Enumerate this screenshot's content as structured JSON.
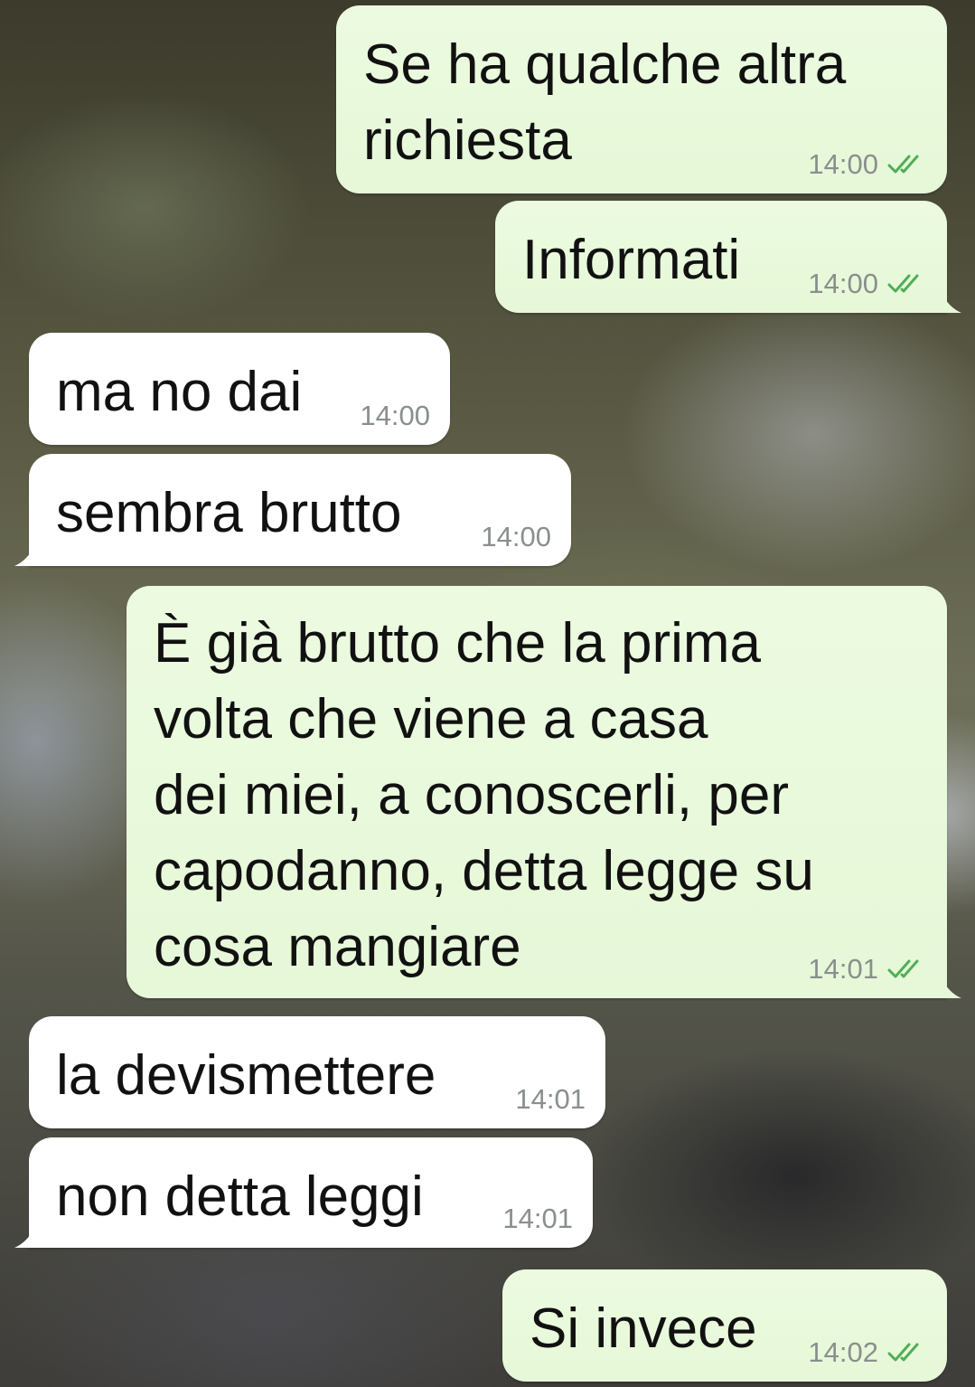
{
  "messages": [
    {
      "direction": "out",
      "text": "Se ha qualche altra\nrichiesta",
      "time": "14:00",
      "status": "read"
    },
    {
      "direction": "out",
      "text": "Informati",
      "time": "14:00",
      "status": "read"
    },
    {
      "direction": "in",
      "text": "ma no dai",
      "time": "14:00"
    },
    {
      "direction": "in",
      "text": "sembra brutto",
      "time": "14:00"
    },
    {
      "direction": "out",
      "text": "È già brutto che la prima\nvolta che viene a casa\ndei miei, a conoscerli, per\ncapodanno, detta legge su\ncosa mangiare",
      "time": "14:01",
      "status": "read"
    },
    {
      "direction": "in",
      "text": "la devismettere",
      "time": "14:01"
    },
    {
      "direction": "in",
      "text": "non detta leggi",
      "time": "14:01"
    },
    {
      "direction": "out",
      "text": "Si invece",
      "time": "14:02",
      "status": "read"
    }
  ],
  "colors": {
    "outgoing_bubble": "#e7fbd9",
    "incoming_bubble": "#ffffff",
    "read_check": "#4fae57",
    "timestamp": "#8a8f8c"
  },
  "icons": {
    "read_receipt": "double-check-icon"
  }
}
